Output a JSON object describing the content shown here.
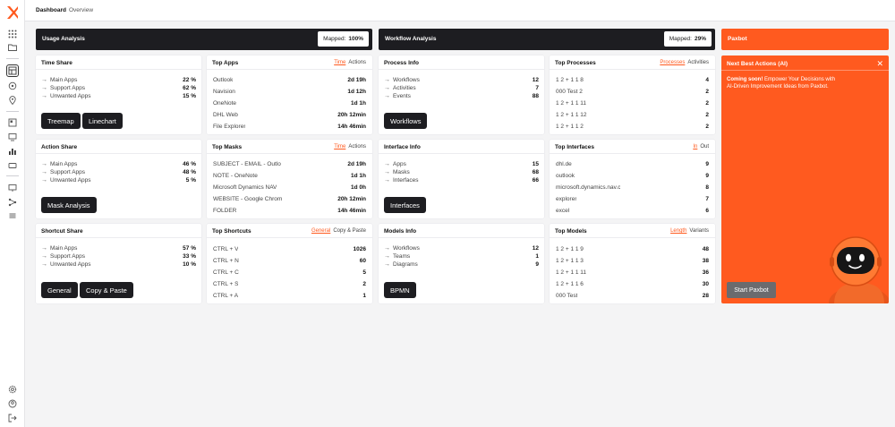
{
  "breadcrumb": {
    "main": "Dashboard",
    "sub": "Overview"
  },
  "sidebar": {
    "icons": [
      "apps-grid-icon",
      "folder-icon",
      "dashboard-icon",
      "radar-icon",
      "location-pin-icon",
      "report-icon",
      "monitor-icon",
      "bar-chart-icon",
      "card-icon",
      "display-icon",
      "network-icon",
      "list-icon"
    ],
    "bottom_icons": [
      "settings-icon",
      "user-icon",
      "logout-icon"
    ]
  },
  "usage_band": {
    "title": "Usage Analysis",
    "mapped_label": "Mapped:",
    "mapped_value": "100%"
  },
  "workflow_band": {
    "title": "Workflow Analysis",
    "mapped_label": "Mapped:",
    "mapped_value": "29%"
  },
  "paxbot_band": {
    "title": "Paxbot"
  },
  "time_share": {
    "title": "Time Share",
    "rows": [
      {
        "label": "Main Apps",
        "value": "22 %"
      },
      {
        "label": "Support Apps",
        "value": "62 %"
      },
      {
        "label": "Unwanted Apps",
        "value": "15 %"
      }
    ],
    "btn1": "Treemap",
    "btn2": "Linechart"
  },
  "action_share": {
    "title": "Action Share",
    "rows": [
      {
        "label": "Main Apps",
        "value": "46 %"
      },
      {
        "label": "Support Apps",
        "value": "48 %"
      },
      {
        "label": "Unwanted Apps",
        "value": "5 %"
      }
    ],
    "btn1": "Mask Analysis"
  },
  "shortcut_share": {
    "title": "Shortcut Share",
    "rows": [
      {
        "label": "Main Apps",
        "value": "57 %"
      },
      {
        "label": "Support Apps",
        "value": "33 %"
      },
      {
        "label": "Unwanted Apps",
        "value": "10 %"
      }
    ],
    "btn1": "General",
    "btn2": "Copy & Paste"
  },
  "top_apps": {
    "title": "Top Apps",
    "link_active": "Time",
    "link_other": "Actions",
    "rows": [
      {
        "label": "Outlook",
        "value": "2d 19h"
      },
      {
        "label": "Navision",
        "value": "1d 12h"
      },
      {
        "label": "OneNote",
        "value": "1d 1h"
      },
      {
        "label": "DHL Web",
        "value": "20h 12min"
      },
      {
        "label": "File Explorer",
        "value": "14h 46min"
      }
    ]
  },
  "top_masks": {
    "title": "Top Masks",
    "link_active": "Time",
    "link_other": "Actions",
    "rows": [
      {
        "label": "SUBJECT - EMAIL - Outlo",
        "value": "2d 19h"
      },
      {
        "label": "NOTE - OneNote",
        "value": "1d 1h"
      },
      {
        "label": "Microsoft Dynamics NAV",
        "value": "1d 0h"
      },
      {
        "label": "WEBSITE - Google Chrom",
        "value": "20h 12min"
      },
      {
        "label": "FOLDER",
        "value": "14h 46min"
      }
    ]
  },
  "top_shortcuts": {
    "title": "Top Shortcuts",
    "link_active": "General",
    "link_other": "Copy & Paste",
    "rows": [
      {
        "label": "CTRL + V",
        "value": "1026"
      },
      {
        "label": "CTRL + N",
        "value": "60"
      },
      {
        "label": "CTRL + C",
        "value": "5"
      },
      {
        "label": "CTRL + S",
        "value": "2"
      },
      {
        "label": "CTRL + A",
        "value": "1"
      }
    ]
  },
  "process_info": {
    "title": "Process Info",
    "rows": [
      {
        "label": "Workflows",
        "value": "12"
      },
      {
        "label": "Activities",
        "value": "7"
      },
      {
        "label": "Events",
        "value": "88"
      }
    ],
    "btn1": "Workflows"
  },
  "interface_info": {
    "title": "Interface Info",
    "rows": [
      {
        "label": "Apps",
        "value": "15"
      },
      {
        "label": "Masks",
        "value": "68"
      },
      {
        "label": "Interfaces",
        "value": "66"
      }
    ],
    "btn1": "Interfaces"
  },
  "models_info": {
    "title": "Models Info",
    "rows": [
      {
        "label": "Workflows",
        "value": "12"
      },
      {
        "label": "Teams",
        "value": "1"
      },
      {
        "label": "Diagrams",
        "value": "9"
      }
    ],
    "btn1": "BPMN"
  },
  "top_processes": {
    "title": "Top Processes",
    "link_active": "Processes",
    "link_other": "Activities",
    "rows": [
      {
        "label": "1 2 + 1 1 8",
        "value": "4"
      },
      {
        "label": "000 Test 2",
        "value": "2"
      },
      {
        "label": "1 2 + 1 1 11",
        "value": "2"
      },
      {
        "label": "1 2 + 1 1 12",
        "value": "2"
      },
      {
        "label": "1 2 + 1 1 2",
        "value": "2"
      }
    ]
  },
  "top_interfaces": {
    "title": "Top Interfaces",
    "link_active": "In",
    "link_other": "Out",
    "rows": [
      {
        "label": "dhl.de",
        "value": "9"
      },
      {
        "label": "outlook",
        "value": "9"
      },
      {
        "label": "microsoft.dynamics.nav.c",
        "value": "8"
      },
      {
        "label": "explorer",
        "value": "7"
      },
      {
        "label": "excel",
        "value": "6"
      }
    ]
  },
  "top_models": {
    "title": "Top Models",
    "link_active": "Length",
    "link_other": "Variants",
    "rows": [
      {
        "label": "1 2 + 1 1 9",
        "value": "48"
      },
      {
        "label": "1 2 + 1 1 3",
        "value": "38"
      },
      {
        "label": "1 2 + 1 1 11",
        "value": "36"
      },
      {
        "label": "1 2 + 1 1 6",
        "value": "30"
      },
      {
        "label": "000 Test",
        "value": "28"
      }
    ]
  },
  "paxbot": {
    "title": "Next Best Actions (AI)",
    "coming_soon": "Coming soon!",
    "text": "Empower Your Decisions with AI-Driven Improvement Ideas from Paxbot.",
    "button": "Start Paxbot",
    "close": "✕"
  }
}
